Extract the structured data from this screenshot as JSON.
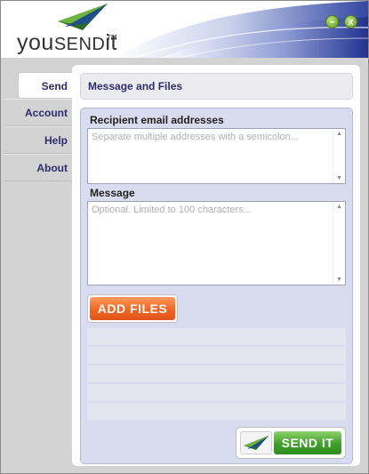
{
  "brand": {
    "logo_text_main": "you",
    "logo_text_caps": "SEND",
    "logo_text_end": "it",
    "trademark": "TM"
  },
  "window_controls": {
    "minimize_label": "–",
    "close_label": "x"
  },
  "nav": {
    "items": [
      {
        "label": "Send",
        "active": true
      },
      {
        "label": "Account",
        "active": false
      },
      {
        "label": "Help",
        "active": false
      },
      {
        "label": "About",
        "active": false
      }
    ]
  },
  "panel": {
    "title": "Message and Files"
  },
  "form": {
    "recipients": {
      "label": "Recipient email addresses",
      "placeholder": "Separate multiple addresses with a semicolon..."
    },
    "message": {
      "label": "Message",
      "placeholder": "Optional. Limited to 100 characters..."
    },
    "add_files_label": "ADD FILES",
    "send_label": "SEND IT"
  },
  "colors": {
    "accent_orange": "#f26522",
    "accent_green": "#3f9f2a",
    "nav_text": "#2d2d6b"
  }
}
